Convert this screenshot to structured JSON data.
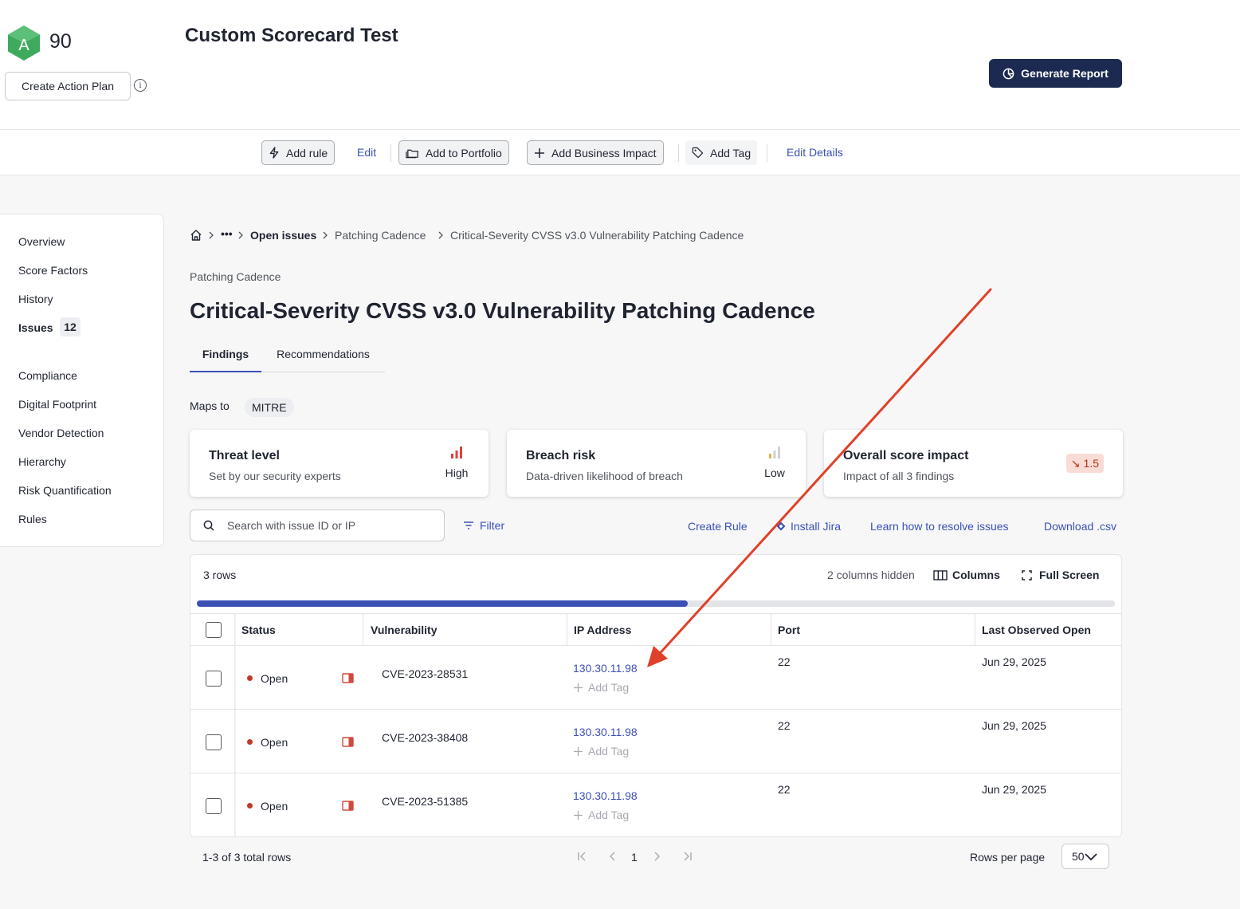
{
  "header": {
    "grade": "A",
    "score": "90",
    "title": "Custom Scorecard Test",
    "create_action_plan": "Create Action Plan",
    "info_glyph": "i",
    "generate_report": "Generate Report"
  },
  "toolbar": {
    "add_rule": "Add rule",
    "edit": "Edit",
    "add_to_portfolio": "Add to Portfolio",
    "add_business_impact": "Add Business Impact",
    "add_tag": "Add Tag",
    "edit_details": "Edit Details"
  },
  "sidebar": {
    "items": [
      {
        "label": "Overview"
      },
      {
        "label": "Score Factors"
      },
      {
        "label": "History"
      },
      {
        "label": "Issues",
        "count": "12"
      },
      {
        "label": "Compliance"
      },
      {
        "label": "Digital Footprint"
      },
      {
        "label": "Vendor Detection"
      },
      {
        "label": "Hierarchy"
      },
      {
        "label": "Risk Quantification"
      },
      {
        "label": "Rules"
      }
    ]
  },
  "breadcrumb": {
    "ellipsis": "•••",
    "items": [
      "Open issues",
      "Patching Cadence",
      "Critical-Severity CVSS v3.0 Vulnerability Patching Cadence"
    ]
  },
  "page": {
    "section": "Patching Cadence",
    "title": "Critical-Severity CVSS v3.0 Vulnerability Patching Cadence",
    "tabs": [
      "Findings",
      "Recommendations"
    ],
    "maps_to_label": "Maps to",
    "maps_to_value": "MITRE"
  },
  "cards": [
    {
      "title": "Threat level",
      "subtitle": "Set by our security experts",
      "level": "High",
      "color": "#e0413a"
    },
    {
      "title": "Breach risk",
      "subtitle": "Data-driven likelihood of breach",
      "level": "Low",
      "color": "#e8b04b"
    },
    {
      "title": "Overall score impact",
      "subtitle": "Impact of all 3 findings",
      "badge_arrow": "↘",
      "badge": "1.5"
    }
  ],
  "actions": {
    "search_placeholder": "Search with issue ID or IP",
    "filter": "Filter",
    "create_rule": "Create Rule",
    "install_jira": "Install Jira",
    "learn_how": "Learn how to resolve issues",
    "download_csv": "Download .csv"
  },
  "table": {
    "rows_count": "3 rows",
    "cols_hidden": "2 columns hidden",
    "columns_btn": "Columns",
    "fullscreen_btn": "Full Screen",
    "scroll_fraction": 0.535,
    "headers": [
      "Status",
      "Vulnerability",
      "IP Address",
      "Port",
      "Last Observed Open"
    ],
    "add_tag": "Add Tag",
    "rows": [
      {
        "status": "Open",
        "cve": "CVE-2023-28531",
        "ip": "130.30.11.98",
        "port": "22",
        "last_observed": "Jun 29, 2025"
      },
      {
        "status": "Open",
        "cve": "CVE-2023-38408",
        "ip": "130.30.11.98",
        "port": "22",
        "last_observed": "Jun 29, 2025"
      },
      {
        "status": "Open",
        "cve": "CVE-2023-51385",
        "ip": "130.30.11.98",
        "port": "22",
        "last_observed": "Jun 29, 2025"
      }
    ]
  },
  "footer": {
    "total_rows": "1-3 of 3 total rows",
    "page": "1",
    "rows_per_page_label": "Rows per page",
    "rows_per_page": "50"
  },
  "colors": {
    "accent": "#3b50b5",
    "primary_button": "#1c2a52",
    "grade_green": "#3faa5d",
    "status_open": "#c0392b",
    "annotation_arrow": "#e0402a"
  }
}
